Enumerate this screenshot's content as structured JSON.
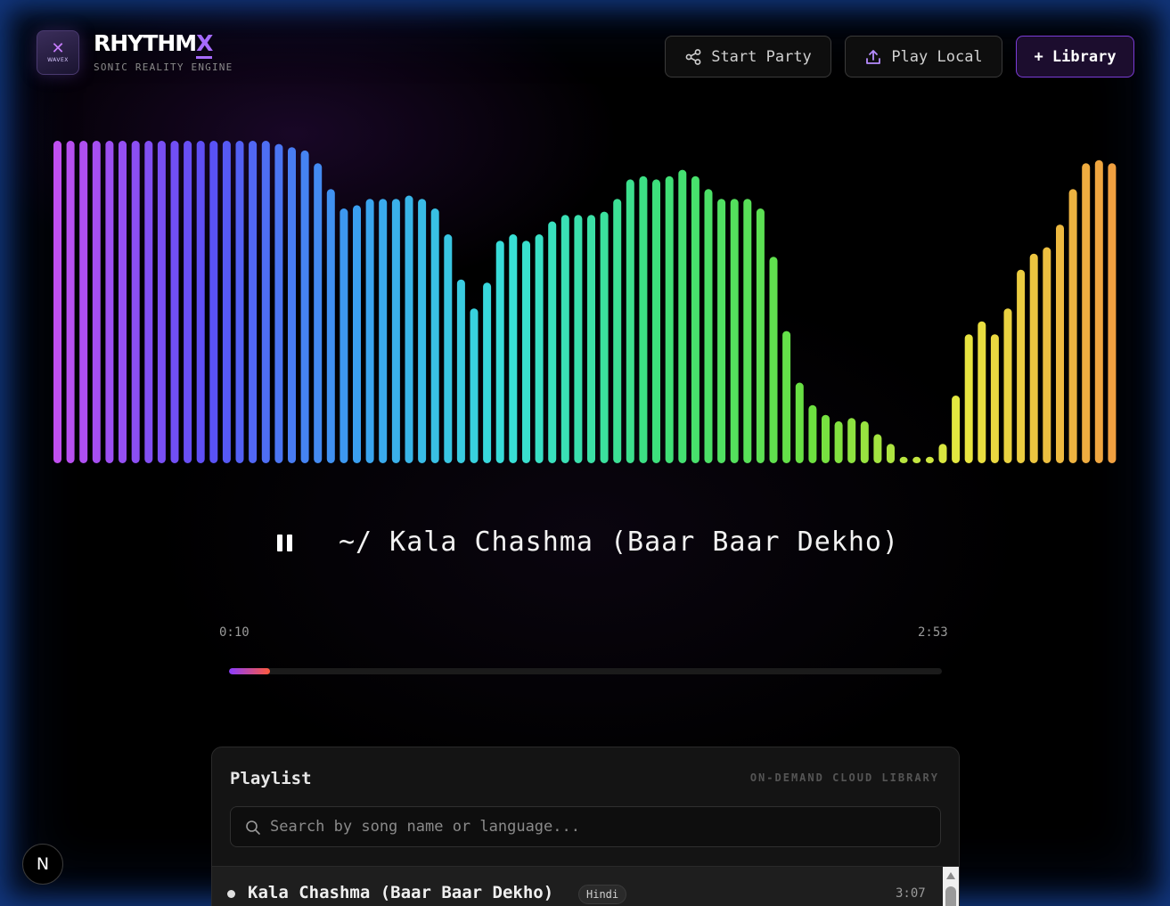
{
  "brand": {
    "logo_mark": "✕",
    "logo_word": "WAVEX",
    "title_main": "RHYTHM",
    "title_accent": "X",
    "subtitle": "SONIC REALITY ENGINE"
  },
  "header": {
    "party_label": "Start Party",
    "local_label": "Play Local",
    "library_label": "+ Library",
    "icons": {
      "party": "share-icon",
      "local": "upload-icon"
    }
  },
  "visualizer": {
    "bar_levels": [
      1.0,
      1.0,
      1.0,
      1.0,
      1.0,
      1.0,
      1.0,
      1.0,
      1.0,
      1.0,
      1.0,
      1.0,
      1.0,
      1.0,
      1.0,
      1.0,
      1.0,
      0.99,
      0.98,
      0.97,
      0.93,
      0.85,
      0.79,
      0.8,
      0.82,
      0.82,
      0.82,
      0.83,
      0.82,
      0.79,
      0.71,
      0.57,
      0.48,
      0.56,
      0.69,
      0.71,
      0.69,
      0.71,
      0.75,
      0.77,
      0.77,
      0.77,
      0.78,
      0.82,
      0.88,
      0.89,
      0.88,
      0.89,
      0.91,
      0.89,
      0.85,
      0.82,
      0.82,
      0.82,
      0.79,
      0.64,
      0.41,
      0.25,
      0.18,
      0.15,
      0.13,
      0.14,
      0.13,
      0.09,
      0.06,
      0.02,
      0.02,
      0.02,
      0.06,
      0.21,
      0.4,
      0.44,
      0.4,
      0.48,
      0.6,
      0.65,
      0.67,
      0.74,
      0.85,
      0.93,
      0.94,
      0.93
    ],
    "colors": [
      "#c04ff0",
      "#5a4ff5",
      "#3aa0f0",
      "#38e0d8",
      "#3de07a",
      "#6be040",
      "#e8e840",
      "#f0a040"
    ]
  },
  "player": {
    "now_playing": "~/ Kala Chashma (Baar Baar Dekho)",
    "current_time": "0:10",
    "duration": "2:53",
    "progress": 0.058
  },
  "playlist": {
    "title": "Playlist",
    "tag": "ON-DEMAND CLOUD LIBRARY",
    "search_placeholder": "Search by song name or language...",
    "items": [
      {
        "title": "Kala Chashma (Baar Baar Dekho)",
        "language": "Hindi",
        "duration": "3:07"
      }
    ]
  },
  "dev_badge": {
    "label": "N"
  }
}
